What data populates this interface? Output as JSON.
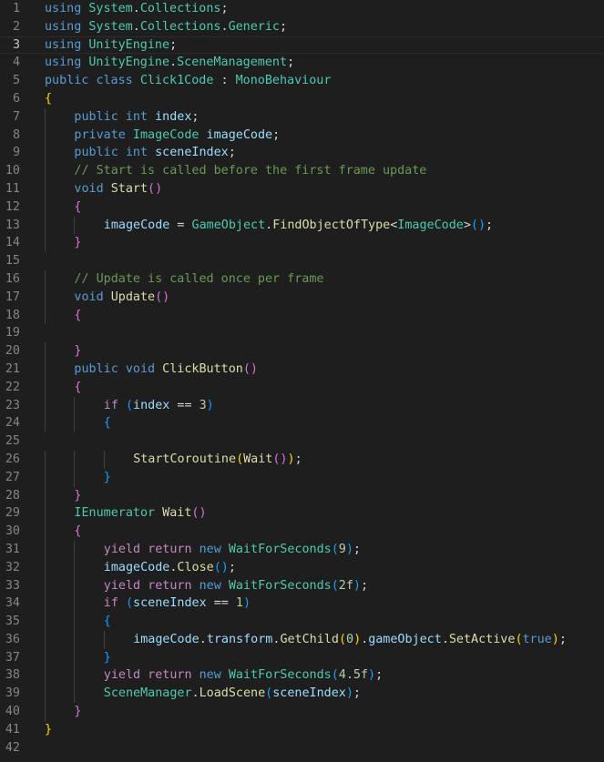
{
  "editor": {
    "theme_colors": {
      "background": "#1e1e1e",
      "keyword": "#569cd6",
      "control": "#c586c0",
      "type": "#4ec9b0",
      "function": "#dcdcaa",
      "variable": "#9cdcfe",
      "number": "#b5cea8",
      "comment": "#6a9955",
      "bracket_level_1": "#ffd700",
      "bracket_level_2": "#da70d6",
      "bracket_level_3": "#179fff",
      "line_number": "#858585"
    },
    "current_line": 3,
    "lines": [
      {
        "n": "1",
        "indent": 0,
        "tokens": [
          [
            "kw",
            "using"
          ],
          [
            "plain",
            " "
          ],
          [
            "typ",
            "System"
          ],
          [
            "plain",
            "."
          ],
          [
            "typ",
            "Collections"
          ],
          [
            "plain",
            ";"
          ]
        ]
      },
      {
        "n": "2",
        "indent": 0,
        "tokens": [
          [
            "kw",
            "using"
          ],
          [
            "plain",
            " "
          ],
          [
            "typ",
            "System"
          ],
          [
            "plain",
            "."
          ],
          [
            "typ",
            "Collections"
          ],
          [
            "plain",
            "."
          ],
          [
            "typ",
            "Generic"
          ],
          [
            "plain",
            ";"
          ]
        ]
      },
      {
        "n": "3",
        "indent": 0,
        "tokens": [
          [
            "kw",
            "using"
          ],
          [
            "plain",
            " "
          ],
          [
            "typ",
            "UnityEngine"
          ],
          [
            "plain",
            ";"
          ]
        ]
      },
      {
        "n": "4",
        "indent": 0,
        "tokens": [
          [
            "kw",
            "using"
          ],
          [
            "plain",
            " "
          ],
          [
            "typ",
            "UnityEngine"
          ],
          [
            "plain",
            "."
          ],
          [
            "typ",
            "SceneManagement"
          ],
          [
            "plain",
            ";"
          ]
        ]
      },
      {
        "n": "5",
        "indent": 0,
        "tokens": [
          [
            "kw",
            "public"
          ],
          [
            "plain",
            " "
          ],
          [
            "kw",
            "class"
          ],
          [
            "plain",
            " "
          ],
          [
            "typ",
            "Click1Code"
          ],
          [
            "plain",
            " : "
          ],
          [
            "typ",
            "MonoBehaviour"
          ]
        ]
      },
      {
        "n": "6",
        "indent": 0,
        "tokens": [
          [
            "p1",
            "{"
          ]
        ]
      },
      {
        "n": "7",
        "indent": 1,
        "tokens": [
          [
            "kw",
            "public"
          ],
          [
            "plain",
            " "
          ],
          [
            "kw",
            "int"
          ],
          [
            "plain",
            " "
          ],
          [
            "var",
            "index"
          ],
          [
            "plain",
            ";"
          ]
        ]
      },
      {
        "n": "8",
        "indent": 1,
        "tokens": [
          [
            "kw",
            "private"
          ],
          [
            "plain",
            " "
          ],
          [
            "typ",
            "ImageCode"
          ],
          [
            "plain",
            " "
          ],
          [
            "var",
            "imageCode"
          ],
          [
            "plain",
            ";"
          ]
        ]
      },
      {
        "n": "9",
        "indent": 1,
        "tokens": [
          [
            "kw",
            "public"
          ],
          [
            "plain",
            " "
          ],
          [
            "kw",
            "int"
          ],
          [
            "plain",
            " "
          ],
          [
            "var",
            "sceneIndex"
          ],
          [
            "plain",
            ";"
          ]
        ]
      },
      {
        "n": "10",
        "indent": 1,
        "tokens": [
          [
            "cmt",
            "// Start is called before the first frame update"
          ]
        ]
      },
      {
        "n": "11",
        "indent": 1,
        "tokens": [
          [
            "kw",
            "void"
          ],
          [
            "plain",
            " "
          ],
          [
            "fn",
            "Start"
          ],
          [
            "p2",
            "()"
          ]
        ]
      },
      {
        "n": "12",
        "indent": 1,
        "tokens": [
          [
            "p2",
            "{"
          ]
        ]
      },
      {
        "n": "13",
        "indent": 2,
        "tokens": [
          [
            "var",
            "imageCode"
          ],
          [
            "plain",
            " = "
          ],
          [
            "typ",
            "GameObject"
          ],
          [
            "plain",
            "."
          ],
          [
            "fn",
            "FindObjectOfType"
          ],
          [
            "plain",
            "<"
          ],
          [
            "typ",
            "ImageCode"
          ],
          [
            "plain",
            ">"
          ],
          [
            "p3",
            "()"
          ],
          [
            "plain",
            ";"
          ]
        ]
      },
      {
        "n": "14",
        "indent": 1,
        "tokens": [
          [
            "p2",
            "}"
          ]
        ]
      },
      {
        "n": "15",
        "indent": 0,
        "tokens": []
      },
      {
        "n": "16",
        "indent": 1,
        "tokens": [
          [
            "cmt",
            "// Update is called once per frame"
          ]
        ]
      },
      {
        "n": "17",
        "indent": 1,
        "tokens": [
          [
            "kw",
            "void"
          ],
          [
            "plain",
            " "
          ],
          [
            "fn",
            "Update"
          ],
          [
            "p2",
            "()"
          ]
        ]
      },
      {
        "n": "18",
        "indent": 1,
        "tokens": [
          [
            "p2",
            "{"
          ]
        ]
      },
      {
        "n": "19",
        "indent": 0,
        "tokens": []
      },
      {
        "n": "20",
        "indent": 1,
        "tokens": [
          [
            "p2",
            "}"
          ]
        ]
      },
      {
        "n": "21",
        "indent": 1,
        "tokens": [
          [
            "kw",
            "public"
          ],
          [
            "plain",
            " "
          ],
          [
            "kw",
            "void"
          ],
          [
            "plain",
            " "
          ],
          [
            "fn",
            "ClickButton"
          ],
          [
            "p2",
            "()"
          ]
        ]
      },
      {
        "n": "22",
        "indent": 1,
        "tokens": [
          [
            "p2",
            "{"
          ]
        ]
      },
      {
        "n": "23",
        "indent": 2,
        "tokens": [
          [
            "ctrl",
            "if"
          ],
          [
            "plain",
            " "
          ],
          [
            "p3",
            "("
          ],
          [
            "var",
            "index"
          ],
          [
            "plain",
            " == "
          ],
          [
            "num",
            "3"
          ],
          [
            "p3",
            ")"
          ]
        ]
      },
      {
        "n": "24",
        "indent": 2,
        "tokens": [
          [
            "p3",
            "{"
          ]
        ]
      },
      {
        "n": "25",
        "indent": 0,
        "tokens": []
      },
      {
        "n": "26",
        "indent": 3,
        "tokens": [
          [
            "fn",
            "StartCoroutine"
          ],
          [
            "p1",
            "("
          ],
          [
            "fn",
            "Wait"
          ],
          [
            "p2",
            "()"
          ],
          [
            "p1",
            ")"
          ],
          [
            "plain",
            ";"
          ]
        ]
      },
      {
        "n": "27",
        "indent": 2,
        "tokens": [
          [
            "p3",
            "}"
          ]
        ]
      },
      {
        "n": "28",
        "indent": 1,
        "tokens": [
          [
            "p2",
            "}"
          ]
        ]
      },
      {
        "n": "29",
        "indent": 1,
        "tokens": [
          [
            "typ",
            "IEnumerator"
          ],
          [
            "plain",
            " "
          ],
          [
            "fn",
            "Wait"
          ],
          [
            "p2",
            "()"
          ]
        ]
      },
      {
        "n": "30",
        "indent": 1,
        "tokens": [
          [
            "p2",
            "{"
          ]
        ]
      },
      {
        "n": "31",
        "indent": 2,
        "tokens": [
          [
            "ctrl",
            "yield"
          ],
          [
            "plain",
            " "
          ],
          [
            "ctrl",
            "return"
          ],
          [
            "plain",
            " "
          ],
          [
            "kw",
            "new"
          ],
          [
            "plain",
            " "
          ],
          [
            "typ",
            "WaitForSeconds"
          ],
          [
            "p3",
            "("
          ],
          [
            "num",
            "9"
          ],
          [
            "p3",
            ")"
          ],
          [
            "plain",
            ";"
          ]
        ]
      },
      {
        "n": "32",
        "indent": 2,
        "tokens": [
          [
            "var",
            "imageCode"
          ],
          [
            "plain",
            "."
          ],
          [
            "fn",
            "Close"
          ],
          [
            "p3",
            "()"
          ],
          [
            "plain",
            ";"
          ]
        ]
      },
      {
        "n": "33",
        "indent": 2,
        "tokens": [
          [
            "ctrl",
            "yield"
          ],
          [
            "plain",
            " "
          ],
          [
            "ctrl",
            "return"
          ],
          [
            "plain",
            " "
          ],
          [
            "kw",
            "new"
          ],
          [
            "plain",
            " "
          ],
          [
            "typ",
            "WaitForSeconds"
          ],
          [
            "p3",
            "("
          ],
          [
            "num",
            "2f"
          ],
          [
            "p3",
            ")"
          ],
          [
            "plain",
            ";"
          ]
        ]
      },
      {
        "n": "34",
        "indent": 2,
        "tokens": [
          [
            "ctrl",
            "if"
          ],
          [
            "plain",
            " "
          ],
          [
            "p3",
            "("
          ],
          [
            "var",
            "sceneIndex"
          ],
          [
            "plain",
            " == "
          ],
          [
            "num",
            "1"
          ],
          [
            "p3",
            ")"
          ]
        ]
      },
      {
        "n": "35",
        "indent": 2,
        "tokens": [
          [
            "p3",
            "{"
          ]
        ]
      },
      {
        "n": "36",
        "indent": 3,
        "tokens": [
          [
            "var",
            "imageCode"
          ],
          [
            "plain",
            "."
          ],
          [
            "var",
            "transform"
          ],
          [
            "plain",
            "."
          ],
          [
            "fn",
            "GetChild"
          ],
          [
            "p1",
            "("
          ],
          [
            "num",
            "0"
          ],
          [
            "p1",
            ")"
          ],
          [
            "plain",
            "."
          ],
          [
            "var",
            "gameObject"
          ],
          [
            "plain",
            "."
          ],
          [
            "fn",
            "SetActive"
          ],
          [
            "p1",
            "("
          ],
          [
            "kw",
            "true"
          ],
          [
            "p1",
            ")"
          ],
          [
            "plain",
            ";"
          ]
        ]
      },
      {
        "n": "37",
        "indent": 2,
        "tokens": [
          [
            "p3",
            "}"
          ]
        ]
      },
      {
        "n": "38",
        "indent": 2,
        "tokens": [
          [
            "ctrl",
            "yield"
          ],
          [
            "plain",
            " "
          ],
          [
            "ctrl",
            "return"
          ],
          [
            "plain",
            " "
          ],
          [
            "kw",
            "new"
          ],
          [
            "plain",
            " "
          ],
          [
            "typ",
            "WaitForSeconds"
          ],
          [
            "p3",
            "("
          ],
          [
            "num",
            "4.5f"
          ],
          [
            "p3",
            ")"
          ],
          [
            "plain",
            ";"
          ]
        ]
      },
      {
        "n": "39",
        "indent": 2,
        "tokens": [
          [
            "typ",
            "SceneManager"
          ],
          [
            "plain",
            "."
          ],
          [
            "fn",
            "LoadScene"
          ],
          [
            "p3",
            "("
          ],
          [
            "var",
            "sceneIndex"
          ],
          [
            "p3",
            ")"
          ],
          [
            "plain",
            ";"
          ]
        ]
      },
      {
        "n": "40",
        "indent": 1,
        "tokens": [
          [
            "p2",
            "}"
          ]
        ]
      },
      {
        "n": "41",
        "indent": 0,
        "tokens": [
          [
            "p1",
            "}"
          ]
        ]
      },
      {
        "n": "42",
        "indent": 0,
        "tokens": []
      }
    ]
  }
}
